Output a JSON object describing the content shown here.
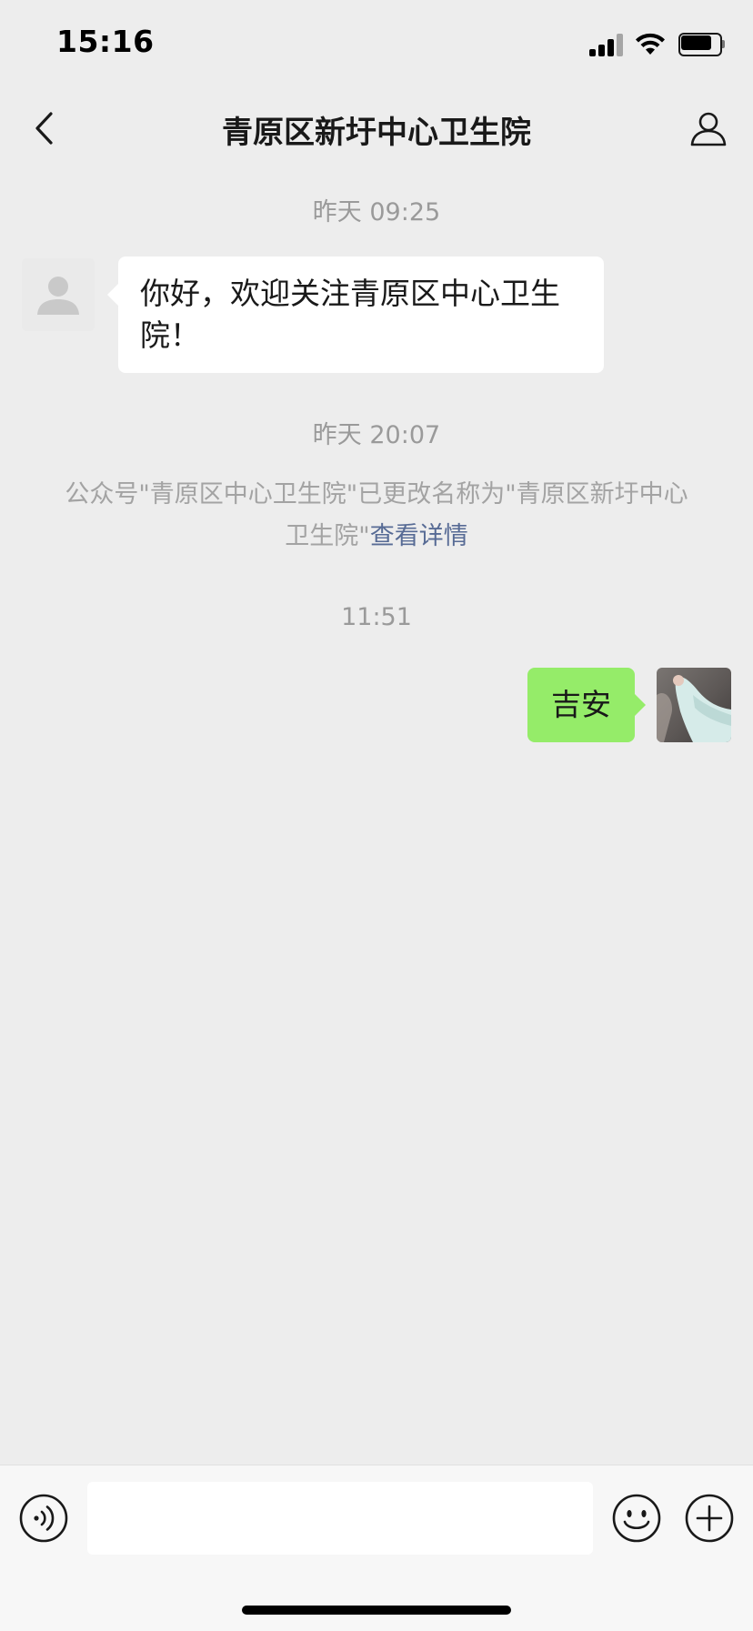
{
  "status_bar": {
    "time": "15:16",
    "battery_level": 0.82,
    "signal_bars": 3
  },
  "nav": {
    "title": "青原区新圩中心卫生院",
    "back_icon": "chevron-left-icon",
    "profile_icon": "person-icon"
  },
  "chat": {
    "timestamps": [
      "昨天 09:25",
      "昨天 20:07",
      "11:51"
    ],
    "incoming_message": "你好，欢迎关注青原区中心卫生院！",
    "system_notice": {
      "text": "公众号\"青原区中心卫生院\"已更改名称为\"青原区新圩中心卫生院\"",
      "link": "查看详情"
    },
    "outgoing_message": "吉安"
  },
  "input_bar": {
    "voice_icon": "voice-icon",
    "emoji_icon": "emoji-icon",
    "plus_icon": "plus-icon",
    "input_value": ""
  },
  "colors": {
    "background": "#ededed",
    "outgoing_bubble": "#95ec69",
    "incoming_bubble": "#ffffff",
    "link": "#576b95",
    "timestamp": "#9a9a9a"
  }
}
